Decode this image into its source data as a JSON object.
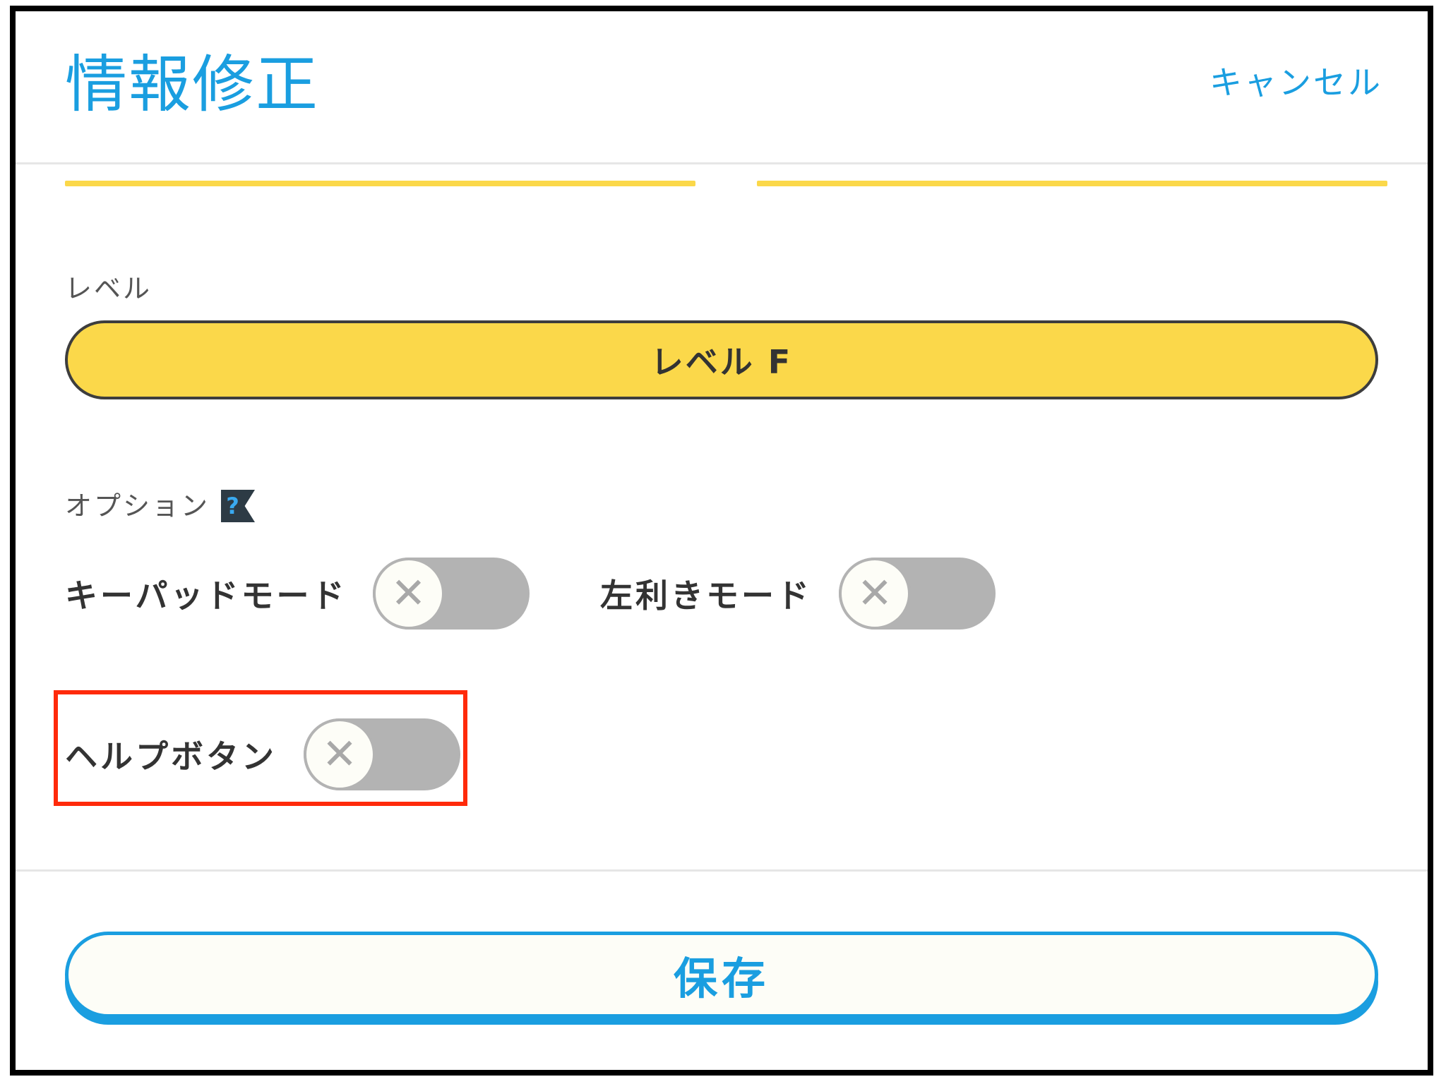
{
  "header": {
    "title": "情報修正",
    "cancel_label": "キャンセル"
  },
  "level": {
    "section_label": "レベル",
    "selected_value": "レベル F"
  },
  "options": {
    "section_label": "オプション",
    "help_icon_glyph": "?",
    "items": [
      {
        "label": "キーパッドモード",
        "enabled": false
      },
      {
        "label": "左利きモード",
        "enabled": false
      },
      {
        "label": "ヘルプボタン",
        "enabled": false
      }
    ]
  },
  "footer": {
    "save_label": "保存"
  },
  "colors": {
    "accent_blue": "#1a9ee0",
    "accent_yellow": "#fbd84a",
    "toggle_off": "#b3b3b3",
    "highlight_red": "#ff2a0a"
  }
}
